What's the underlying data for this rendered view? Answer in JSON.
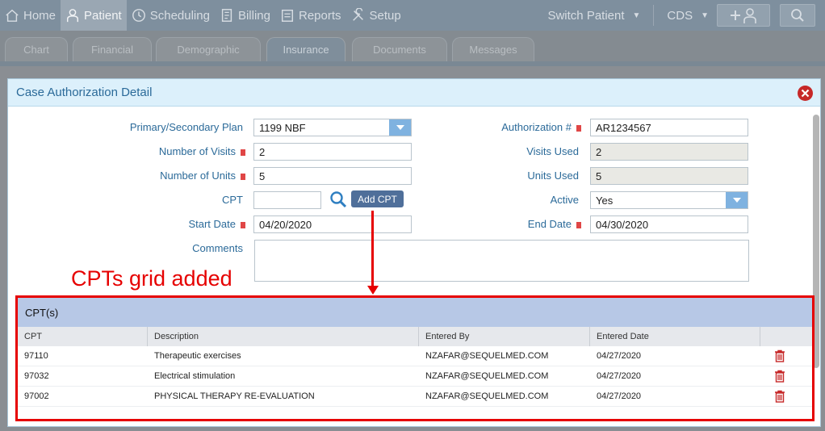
{
  "nav": {
    "items": [
      {
        "label": "Home",
        "icon": "home-icon"
      },
      {
        "label": "Patient",
        "icon": "user-icon"
      },
      {
        "label": "Scheduling",
        "icon": "clock-icon"
      },
      {
        "label": "Billing",
        "icon": "billing-icon"
      },
      {
        "label": "Reports",
        "icon": "reports-icon"
      },
      {
        "label": "Setup",
        "icon": "tools-icon"
      }
    ],
    "switch_patient": "Switch Patient",
    "cds": "CDS"
  },
  "tabs": [
    "Chart",
    "Financial",
    "Demographic",
    "Insurance",
    "Documents",
    "Messages"
  ],
  "modal": {
    "title": "Case Authorization Detail",
    "labels": {
      "primary_plan": "Primary/Secondary Plan",
      "num_visits": "Number of Visits",
      "num_units": "Number of Units",
      "cpt": "CPT",
      "start_date": "Start Date",
      "comments": "Comments",
      "auth_no": "Authorization #",
      "visits_used": "Visits Used",
      "units_used": "Units Used",
      "active": "Active",
      "end_date": "End Date"
    },
    "values": {
      "primary_plan": "1199 NBF",
      "num_visits": "2",
      "num_units": "5",
      "cpt": "",
      "start_date": "04/20/2020",
      "comments": "",
      "auth_no": "AR1234567",
      "visits_used": "2",
      "units_used": "5",
      "active": "Yes",
      "end_date": "04/30/2020"
    },
    "add_cpt_label": "Add CPT"
  },
  "annotation": "CPTs grid added",
  "cpt_grid": {
    "title": "CPT(s)",
    "columns": [
      "CPT",
      "Description",
      "Entered By",
      "Entered Date",
      ""
    ],
    "rows": [
      {
        "cpt": "97110",
        "description": "Therapeutic exercises",
        "entered_by": "NZAFAR@SEQUELMED.COM",
        "entered_date": "04/27/2020"
      },
      {
        "cpt": "97032",
        "description": "Electrical stimulation",
        "entered_by": "NZAFAR@SEQUELMED.COM",
        "entered_date": "04/27/2020"
      },
      {
        "cpt": "97002",
        "description": "PHYSICAL THERAPY RE-EVALUATION",
        "entered_by": "NZAFAR@SEQUELMED.COM",
        "entered_date": "04/27/2020"
      }
    ]
  },
  "colors": {
    "accent": "#2b6a99",
    "annotation": "#e60000",
    "grid_header": "#b7c8e6",
    "delete": "#c62828"
  }
}
